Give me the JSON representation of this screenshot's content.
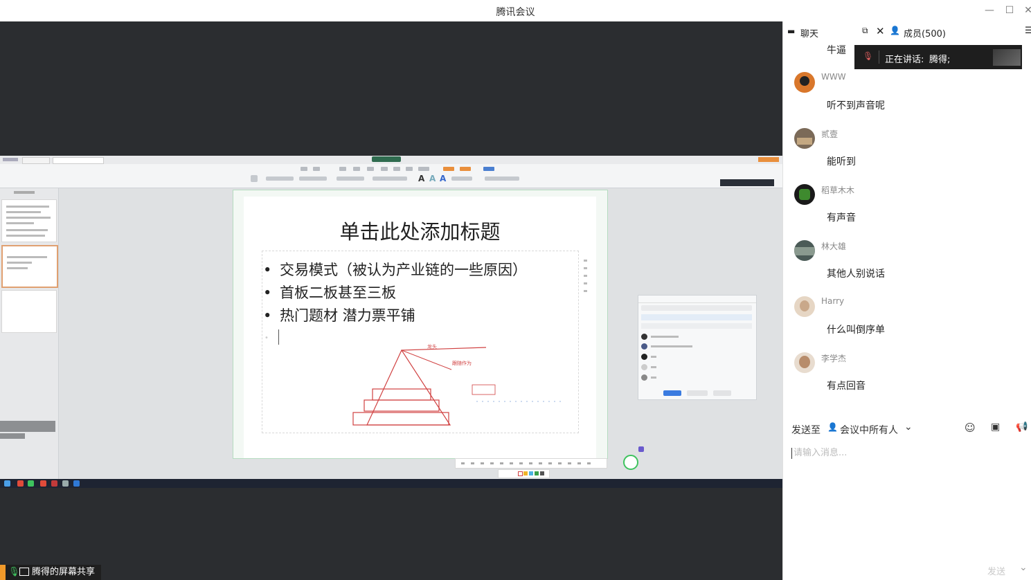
{
  "window": {
    "title": "腾讯会议"
  },
  "chat": {
    "tab_chat": "聊天",
    "tab_members": "成员(500)",
    "speaking_label": "正在讲话:",
    "speaking_name": "腾得;",
    "first_message": "牛逼",
    "messages": [
      {
        "name": "WWW",
        "text": "听不到声音呢",
        "avatar_color": "#d9772b"
      },
      {
        "name": "贰壹",
        "text": "能听到",
        "avatar_color": "#7b6a58"
      },
      {
        "name": "稻草木木",
        "text": "有声音",
        "avatar_color": "#3e8a2e"
      },
      {
        "name": "林大雄",
        "text": "其他人别说话",
        "avatar_color": "#4b5b57"
      },
      {
        "name": "Harry",
        "text": "什么叫倒序单",
        "avatar_color": "#c9a88a"
      },
      {
        "name": "李学杰",
        "text": "有点回音",
        "avatar_color": "#b78c6b"
      }
    ],
    "send_to_label": "发送至",
    "send_to_target": "会议中所有人",
    "input_placeholder": "请输入消息...",
    "send_button": "发送"
  },
  "share": {
    "presenter_label": "腾得的屏幕共享",
    "slide": {
      "title": "单击此处添加标题",
      "bullets": [
        "交易模式（被认为产业链的一些原因）",
        "首板二板甚至三板",
        "热门题材 潜力票平铺"
      ],
      "annotations": [
        "龙头",
        "跟随作为"
      ]
    }
  },
  "colors": {
    "accent_green": "#3ec35e",
    "annotation_red": "#d04040",
    "dark_stage": "#2b2d30"
  }
}
